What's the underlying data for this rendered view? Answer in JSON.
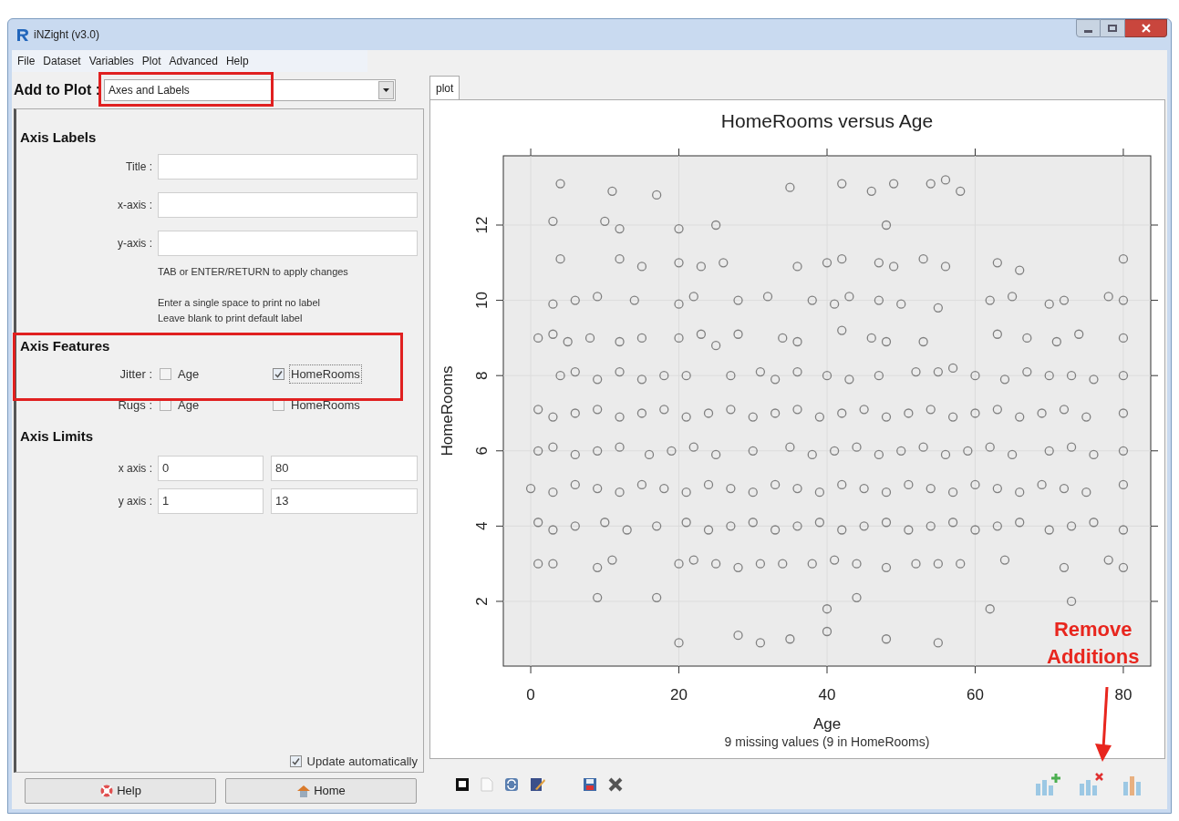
{
  "window": {
    "title": "iNZight (v3.0)"
  },
  "menu": [
    "File",
    "Dataset",
    "Variables",
    "Plot",
    "Advanced",
    "Help"
  ],
  "add_to_plot": {
    "label": "Add to Plot :",
    "value": "Axes and Labels"
  },
  "axis_labels": {
    "heading": "Axis Labels",
    "fields": [
      {
        "label": "Title :"
      },
      {
        "label": "x-axis :"
      },
      {
        "label": "y-axis :"
      }
    ],
    "hints": [
      "TAB or ENTER/RETURN to apply changes",
      "Enter a single space to print no label",
      "Leave blank to print default label"
    ]
  },
  "axis_features": {
    "heading": "Axis Features",
    "rows": [
      {
        "label": "Jitter :",
        "options": [
          {
            "label": "Age",
            "checked": false,
            "focused": false
          },
          {
            "label": "HomeRooms",
            "checked": true,
            "focused": true
          }
        ]
      },
      {
        "label": "Rugs :",
        "options": [
          {
            "label": "Age",
            "checked": false,
            "focused": false
          },
          {
            "label": "HomeRooms",
            "checked": false,
            "focused": false
          }
        ]
      }
    ]
  },
  "axis_limits": {
    "heading": "Axis Limits",
    "rows": [
      {
        "label": "x axis :",
        "min": "0",
        "max": "80"
      },
      {
        "label": "y axis :",
        "min": "1",
        "max": "13"
      }
    ]
  },
  "update_automatically": {
    "label": "Update automatically",
    "checked": true
  },
  "buttons": [
    {
      "label": "Help"
    },
    {
      "label": "Home"
    }
  ],
  "tabs": [
    {
      "label": "plot",
      "selected": true
    }
  ],
  "plot": {
    "note": "9 missing values (9 in HomeRooms)",
    "chart_data": {
      "type": "scatter",
      "title": "HomeRooms versus Age",
      "xlabel": "Age",
      "ylabel": "HomeRooms",
      "grid": true,
      "xlim": [
        -3.7,
        83.7
      ],
      "ylim": [
        0.28,
        13.84
      ],
      "xticks": [
        0,
        20,
        40,
        60,
        80
      ],
      "yticks": [
        2,
        4,
        6,
        8,
        10,
        12
      ],
      "x": [
        4,
        11,
        17,
        35,
        42,
        46,
        49,
        54,
        56,
        58,
        3,
        10,
        12,
        20,
        25,
        48,
        4,
        12,
        15,
        20,
        23,
        26,
        36,
        40,
        42,
        47,
        49,
        53,
        56,
        63,
        66,
        80,
        3,
        6,
        9,
        14,
        20,
        22,
        28,
        32,
        38,
        41,
        43,
        47,
        50,
        55,
        62,
        65,
        70,
        72,
        78,
        80,
        1,
        3,
        5,
        8,
        12,
        15,
        20,
        23,
        25,
        28,
        34,
        36,
        42,
        46,
        48,
        53,
        63,
        67,
        71,
        74,
        80,
        4,
        6,
        9,
        12,
        15,
        18,
        21,
        27,
        31,
        33,
        36,
        40,
        43,
        47,
        52,
        55,
        57,
        60,
        64,
        67,
        70,
        73,
        76,
        80,
        1,
        3,
        6,
        9,
        12,
        15,
        18,
        21,
        24,
        27,
        30,
        33,
        36,
        39,
        42,
        45,
        48,
        51,
        54,
        57,
        60,
        63,
        66,
        69,
        72,
        75,
        80,
        1,
        3,
        6,
        9,
        12,
        16,
        19,
        22,
        25,
        30,
        35,
        38,
        41,
        44,
        47,
        50,
        53,
        56,
        59,
        62,
        65,
        70,
        73,
        76,
        80,
        0,
        3,
        6,
        9,
        12,
        15,
        18,
        21,
        24,
        27,
        30,
        33,
        36,
        39,
        42,
        45,
        48,
        51,
        54,
        57,
        60,
        63,
        66,
        69,
        72,
        75,
        80,
        1,
        3,
        6,
        10,
        13,
        17,
        21,
        24,
        27,
        30,
        33,
        36,
        39,
        42,
        45,
        48,
        51,
        54,
        57,
        60,
        63,
        66,
        70,
        73,
        76,
        80,
        1,
        3,
        9,
        11,
        20,
        22,
        25,
        28,
        31,
        34,
        38,
        41,
        44,
        48,
        52,
        55,
        58,
        64,
        72,
        78,
        80,
        9,
        17,
        40,
        44,
        62,
        73,
        20,
        28,
        31,
        35,
        40,
        48,
        55
      ],
      "series": [
        {
          "color": "#808080",
          "values": [
            13.1,
            12.9,
            12.8,
            13,
            13.1,
            12.9,
            13.1,
            13.1,
            13.2,
            12.9,
            12.1,
            12.1,
            11.9,
            11.9,
            12,
            12,
            11.1,
            11.1,
            10.9,
            11,
            10.9,
            11,
            10.9,
            11,
            11.1,
            11,
            10.9,
            11.1,
            10.9,
            11,
            10.8,
            11.1,
            9.9,
            10,
            10.1,
            10,
            9.9,
            10.1,
            10,
            10.1,
            10,
            9.9,
            10.1,
            10,
            9.9,
            9.8,
            10,
            10.1,
            9.9,
            10,
            10.1,
            10,
            9,
            9.1,
            8.9,
            9,
            8.9,
            9,
            9,
            9.1,
            8.8,
            9.1,
            9,
            8.9,
            9.2,
            9,
            8.9,
            8.9,
            9.1,
            9,
            8.9,
            9.1,
            9,
            8,
            8.1,
            7.9,
            8.1,
            7.9,
            8,
            8,
            8,
            8.1,
            7.9,
            8.1,
            8,
            7.9,
            8,
            8.1,
            8.1,
            8.2,
            8,
            7.9,
            8.1,
            8,
            8,
            7.9,
            8,
            7.1,
            6.9,
            7,
            7.1,
            6.9,
            7,
            7.1,
            6.9,
            7,
            7.1,
            6.9,
            7,
            7.1,
            6.9,
            7,
            7.1,
            6.9,
            7,
            7.1,
            6.9,
            7,
            7.1,
            6.9,
            7,
            7.1,
            6.9,
            7,
            6,
            6.1,
            5.9,
            6,
            6.1,
            5.9,
            6,
            6.1,
            5.9,
            6,
            6.1,
            5.9,
            6,
            6.1,
            5.9,
            6,
            6.1,
            5.9,
            6,
            6.1,
            5.9,
            6,
            6.1,
            5.9,
            6,
            5,
            4.9,
            5.1,
            5,
            4.9,
            5.1,
            5,
            4.9,
            5.1,
            5,
            4.9,
            5.1,
            5,
            4.9,
            5.1,
            5,
            4.9,
            5.1,
            5,
            4.9,
            5.1,
            5,
            4.9,
            5.1,
            5,
            4.9,
            5.1,
            4.1,
            3.9,
            4,
            4.1,
            3.9,
            4,
            4.1,
            3.9,
            4,
            4.1,
            3.9,
            4,
            4.1,
            3.9,
            4,
            4.1,
            3.9,
            4,
            4.1,
            3.9,
            4,
            4.1,
            3.9,
            4,
            4.1,
            3.9,
            3,
            3,
            2.9,
            3.1,
            3,
            3.1,
            3,
            2.9,
            3,
            3,
            3,
            3.1,
            3,
            2.9,
            3,
            3,
            3,
            3.1,
            2.9,
            3.1,
            2.9,
            2.1,
            2.1,
            1.8,
            2.1,
            1.8,
            2,
            0.9,
            1.1,
            0.9,
            1,
            1.2,
            1,
            0.9
          ]
        }
      ]
    }
  },
  "callout": {
    "lines": [
      "Remove",
      "Additions"
    ]
  }
}
